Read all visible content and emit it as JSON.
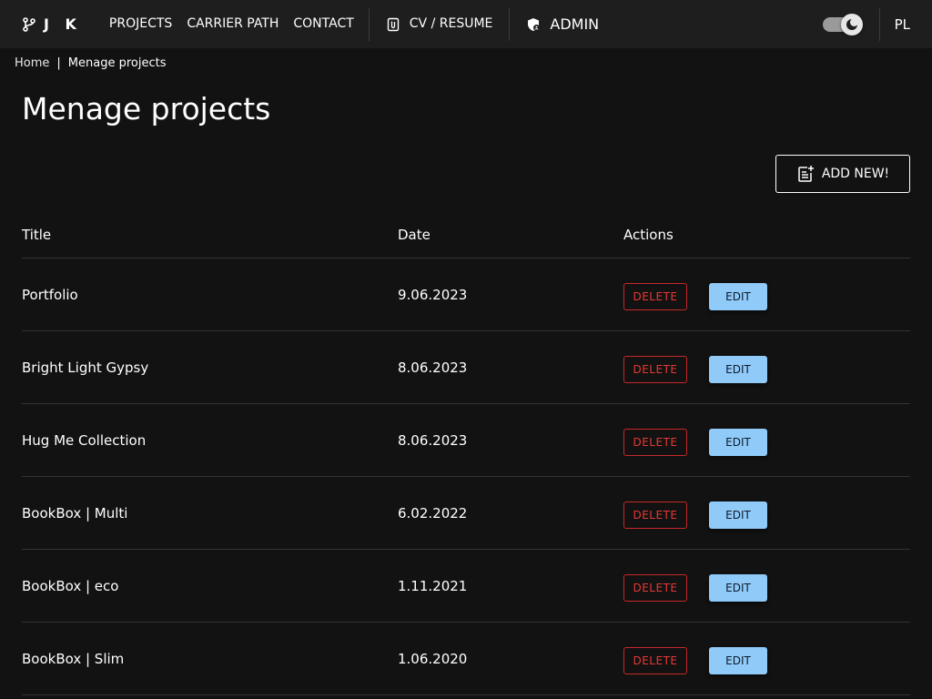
{
  "nav": {
    "brand": "J K",
    "links": [
      "PROJECTS",
      "CARRIER PATH",
      "CONTACT"
    ],
    "cv": "CV / RESUME",
    "admin": "ADMIN",
    "lang": "PL"
  },
  "breadcrumb": {
    "home": "Home",
    "current": "Menage projects"
  },
  "page": {
    "title": "Menage projects",
    "add_label": "ADD NEW!"
  },
  "table": {
    "headers": [
      "Title",
      "Date",
      "Actions"
    ],
    "delete_label": "DELETE",
    "edit_label": "EDIT",
    "rows": [
      {
        "title": "Portfolio",
        "date": "9.06.2023"
      },
      {
        "title": "Bright Light Gypsy",
        "date": "8.06.2023"
      },
      {
        "title": "Hug Me Collection",
        "date": "8.06.2023"
      },
      {
        "title": "BookBox | Multi",
        "date": "6.02.2022"
      },
      {
        "title": "BookBox | eco",
        "date": "1.11.2021"
      },
      {
        "title": "BookBox | Slim",
        "date": "1.06.2020"
      }
    ]
  },
  "colors": {
    "background": "#121212",
    "navbar": "#1e1e1e",
    "delete": "#e53935",
    "edit": "#90caf9"
  },
  "icons": {
    "brand": "git-branch-icon",
    "cv": "paperclip-document-icon",
    "admin": "admin-shield-icon",
    "add": "note-add-icon",
    "theme": "dark-mode-icon"
  }
}
